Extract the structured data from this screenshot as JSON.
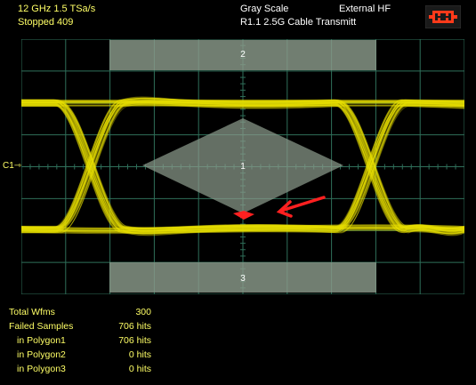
{
  "header": {
    "acquisition": "12 GHz  1.5 TSa/s",
    "status": "Stopped 409",
    "display_mode": "Gray Scale",
    "trigger_source": "External HF",
    "mask_name": "R1.1 2.5G Cable Transmitt",
    "run_control_icon": "stopped-run-control-icon"
  },
  "channel_marker": "C1",
  "mask": {
    "regions": [
      {
        "id": "polygon2",
        "label": "2"
      },
      {
        "id": "polygon1",
        "label": "1"
      },
      {
        "id": "polygon3",
        "label": "3"
      }
    ],
    "colors": {
      "trace": "#e8e000",
      "mask_fill": "#8a9a8a",
      "grid": "#2f6f5a",
      "failure": "#ff2020",
      "annotation_arrow": "#ff2020"
    }
  },
  "stats": [
    {
      "label": "Total Wfms",
      "value": "300",
      "indent": false
    },
    {
      "label": "Failed Samples",
      "value": "706 hits",
      "indent": false
    },
    {
      "label": "in Polygon1",
      "value": "706 hits",
      "indent": true
    },
    {
      "label": "in Polygon2",
      "value": "0 hits",
      "indent": true
    },
    {
      "label": "in Polygon3",
      "value": "0 hits",
      "indent": true
    }
  ]
}
